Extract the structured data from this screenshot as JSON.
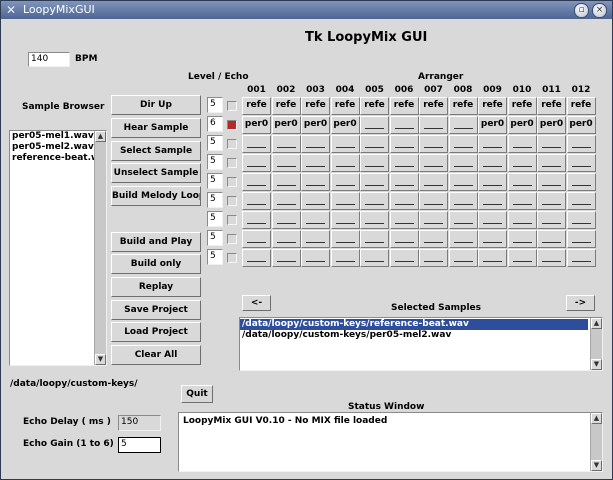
{
  "window": {
    "title": "LoopyMixGUI",
    "app_title": "Tk LoopyMix GUI"
  },
  "bpm": {
    "value": "140",
    "label": "BPM"
  },
  "sample_browser": {
    "title": "Sample Browser",
    "items": [
      "per05-mel1.wav",
      "per05-mel2.wav",
      "reference-beat.wa"
    ]
  },
  "buttons": {
    "dir_up": "Dir Up",
    "hear_sample": "Hear Sample",
    "select_sample": "Select Sample",
    "unselect_sample": "Unselect Sample",
    "build_melody_loop": "Build Melody Loop",
    "build_and_play": "Build and Play",
    "build_only": "Build only",
    "replay": "Replay",
    "save_project": "Save Project",
    "load_project": "Load Project",
    "clear_all": "Clear All",
    "quit": "Quit",
    "arranger_left": "<-",
    "arranger_right": "->"
  },
  "level_echo": {
    "title": "Level / Echo",
    "rows": [
      {
        "level": "5",
        "echo": false
      },
      {
        "level": "6",
        "echo": true
      },
      {
        "level": "5",
        "echo": false
      },
      {
        "level": "5",
        "echo": false
      },
      {
        "level": "5",
        "echo": false
      },
      {
        "level": "5",
        "echo": false
      },
      {
        "level": "5",
        "echo": false
      },
      {
        "level": "5",
        "echo": false
      },
      {
        "level": "5",
        "echo": false
      }
    ]
  },
  "arranger": {
    "title": "Arranger",
    "columns": [
      "001",
      "002",
      "003",
      "004",
      "005",
      "006",
      "007",
      "008",
      "009",
      "010",
      "011",
      "012"
    ],
    "rows": [
      [
        "refe",
        "refe",
        "refe",
        "refe",
        "refe",
        "refe",
        "refe",
        "refe",
        "refe",
        "refe",
        "refe",
        "refe"
      ],
      [
        "per0",
        "per0",
        "per0",
        "per0",
        "",
        "",
        "",
        "",
        "per0",
        "per0",
        "per0",
        "per0"
      ],
      [
        "",
        "",
        "",
        "",
        "",
        "",
        "",
        "",
        "",
        "",
        "",
        ""
      ],
      [
        "",
        "",
        "",
        "",
        "",
        "",
        "",
        "",
        "",
        "",
        "",
        ""
      ],
      [
        "",
        "",
        "",
        "",
        "",
        "",
        "",
        "",
        "",
        "",
        "",
        ""
      ],
      [
        "",
        "",
        "",
        "",
        "",
        "",
        "",
        "",
        "",
        "",
        "",
        ""
      ],
      [
        "",
        "",
        "",
        "",
        "",
        "",
        "",
        "",
        "",
        "",
        "",
        ""
      ],
      [
        "",
        "",
        "",
        "",
        "",
        "",
        "",
        "",
        "",
        "",
        "",
        ""
      ],
      [
        "",
        "",
        "",
        "",
        "",
        "",
        "",
        "",
        "",
        "",
        "",
        ""
      ]
    ]
  },
  "selected_samples": {
    "title": "Selected Samples",
    "items": [
      "/data/loopy/custom-keys/reference-beat.wav",
      "/data/loopy/custom-keys/per05-mel2.wav"
    ]
  },
  "current_dir": "/data/loopy/custom-keys/",
  "echo_delay": {
    "label": "Echo Delay  ( ms )",
    "value": "150"
  },
  "echo_gain": {
    "label": "Echo Gain  (1 to 6)",
    "value": "5"
  },
  "status": {
    "title": "Status Window",
    "text": "LoopyMix GUI V0.10 - No MIX file loaded"
  }
}
